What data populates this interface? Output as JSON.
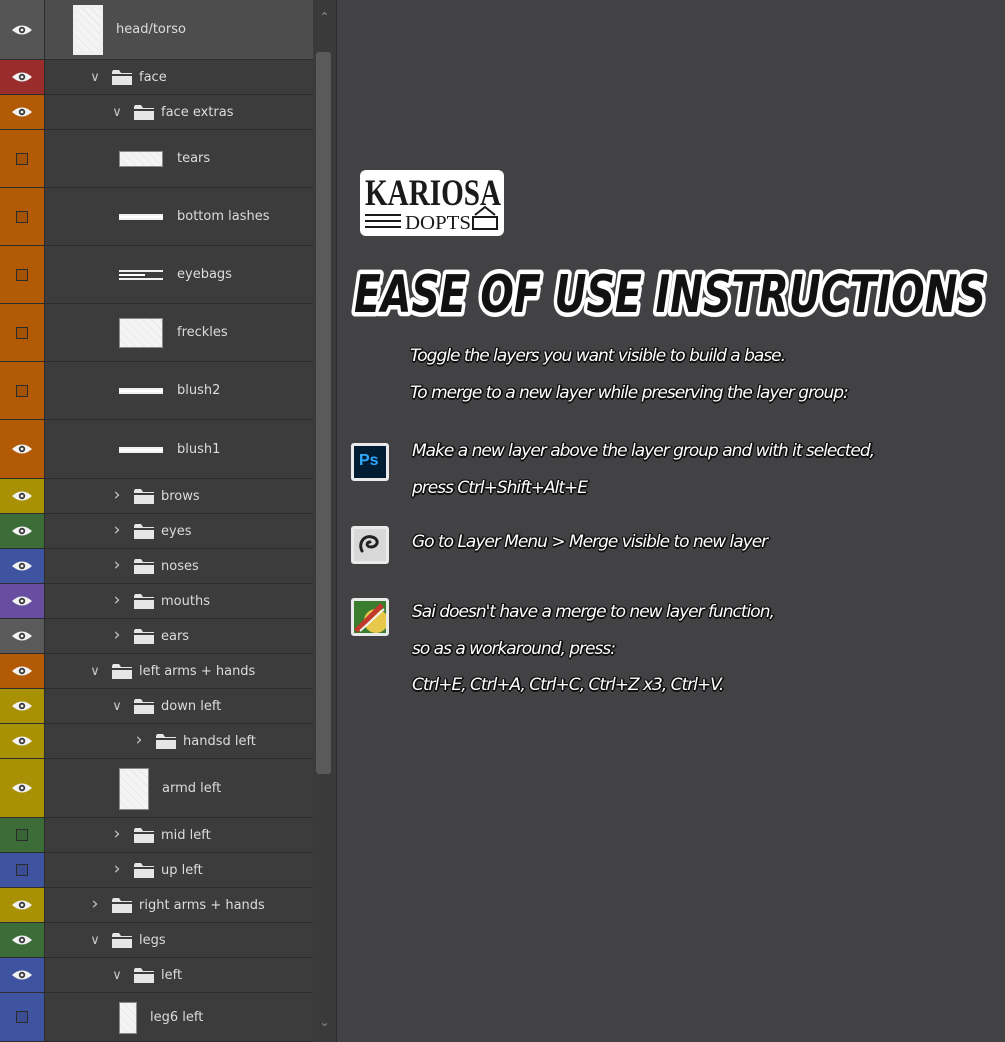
{
  "layers_panel": {
    "rows": [
      {
        "label": "head/torso",
        "color": "#555555",
        "visible": true,
        "kind": "layer-tall"
      },
      {
        "label": "face",
        "color": "#9b2c2c",
        "visible": true,
        "kind": "group-open"
      },
      {
        "label": "face extras",
        "color": "#b25a05",
        "visible": true,
        "kind": "group-open"
      },
      {
        "label": "tears",
        "color": "#b25a05",
        "visible": false,
        "kind": "layer"
      },
      {
        "label": "bottom lashes",
        "color": "#b25a05",
        "visible": false,
        "kind": "layer"
      },
      {
        "label": "eyebags",
        "color": "#b25a05",
        "visible": false,
        "kind": "layer"
      },
      {
        "label": "freckles",
        "color": "#b25a05",
        "visible": false,
        "kind": "layer"
      },
      {
        "label": "blush2",
        "color": "#b25a05",
        "visible": false,
        "kind": "layer"
      },
      {
        "label": "blush1",
        "color": "#b25a05",
        "visible": true,
        "kind": "layer"
      },
      {
        "label": "brows",
        "color": "#a89104",
        "visible": true,
        "kind": "group-closed"
      },
      {
        "label": "eyes",
        "color": "#3c6d38",
        "visible": true,
        "kind": "group-closed"
      },
      {
        "label": "noses",
        "color": "#3f54a0",
        "visible": true,
        "kind": "group-closed"
      },
      {
        "label": "mouths",
        "color": "#674ea0",
        "visible": true,
        "kind": "group-closed"
      },
      {
        "label": "ears",
        "color": "#5a5a5a",
        "visible": true,
        "kind": "group-closed"
      },
      {
        "label": "left arms + hands",
        "color": "#b25a05",
        "visible": true,
        "kind": "group-open"
      },
      {
        "label": "down left",
        "color": "#a89104",
        "visible": true,
        "kind": "group-open"
      },
      {
        "label": "handsd left",
        "color": "#a89104",
        "visible": true,
        "kind": "group-closed"
      },
      {
        "label": "armd left",
        "color": "#a89104",
        "visible": true,
        "kind": "layer"
      },
      {
        "label": "mid left",
        "color": "#3c6d38",
        "visible": false,
        "kind": "group-closed"
      },
      {
        "label": "up left",
        "color": "#3f54a0",
        "visible": false,
        "kind": "group-closed"
      },
      {
        "label": "right arms + hands",
        "color": "#a89104",
        "visible": true,
        "kind": "group-closed"
      },
      {
        "label": "legs",
        "color": "#3c6d38",
        "visible": true,
        "kind": "group-open"
      },
      {
        "label": "left",
        "color": "#3f54a0",
        "visible": true,
        "kind": "group-open"
      },
      {
        "label": "leg6 left",
        "color": "#3f54a0",
        "visible": false,
        "kind": "layer"
      }
    ]
  },
  "logo": {
    "line1": "KARIOSA",
    "line2": "DOPTS"
  },
  "heading": "EASE OF USE INSTRUCTIONS",
  "instructions": {
    "intro_line1": "Toggle the layers you want visible to build a base.",
    "intro_line2": "To merge to a new layer while preserving the layer group:",
    "photoshop": {
      "icon": "photoshop-icon",
      "icon_text": "Ps",
      "line1": "Make a new layer above the layer group and with it selected,",
      "line2": "press Ctrl+Shift+Alt+E"
    },
    "clipstudio": {
      "icon": "clip-studio-icon",
      "line1": "Go to Layer Menu > Merge visible to new layer"
    },
    "sai": {
      "icon": "sai-icon",
      "line1": "Sai doesn't have a merge to new layer  function,",
      "line2": "so as a workaround, press:",
      "line3": " Ctrl+E, Ctrl+A, Ctrl+C, Ctrl+Z x3, Ctrl+V."
    }
  },
  "colors": {
    "background": "#424244",
    "panel": "#3c3c3c",
    "text": "#ffffff"
  }
}
